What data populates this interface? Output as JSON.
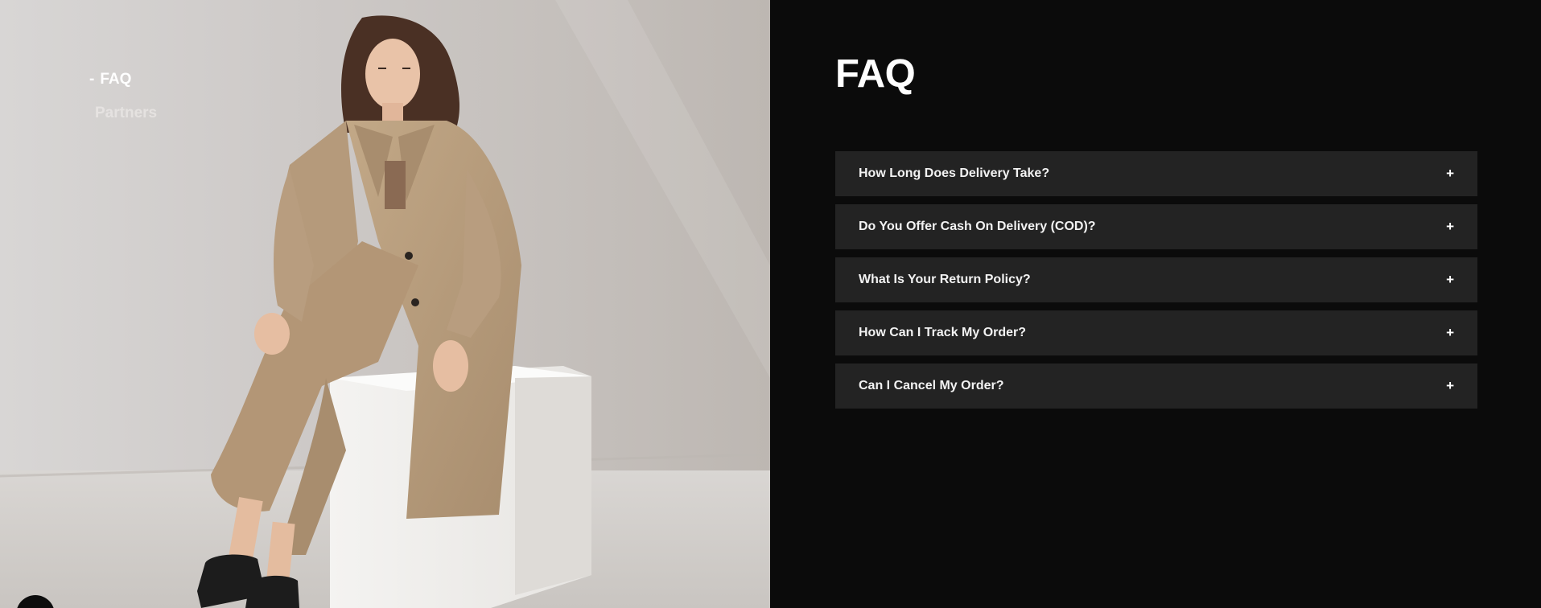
{
  "side_nav": {
    "items": [
      {
        "label": "FAQ",
        "marker": "-",
        "active": true
      },
      {
        "label": "Partners",
        "active": false
      }
    ]
  },
  "hero_image": {
    "alt": "Model in a beige trench coat and wide-leg trousers seated on a white cube"
  },
  "scroll_button": {
    "icon": "chevron-up-icon",
    "glyph": "⌃"
  },
  "faq": {
    "title": "FAQ",
    "expand_glyph": "+",
    "items": [
      {
        "question": "How Long Does Delivery Take?"
      },
      {
        "question": "Do You Offer Cash On Delivery (COD)?"
      },
      {
        "question": "What Is Your Return Policy?"
      },
      {
        "question": "How Can I Track My Order?"
      },
      {
        "question": "Can I Cancel My Order?"
      }
    ]
  },
  "colors": {
    "panel_bg": "#0b0b0b",
    "accordion_bg": "#232323",
    "text_primary": "#ffffff",
    "coat": "#b89d7f"
  }
}
